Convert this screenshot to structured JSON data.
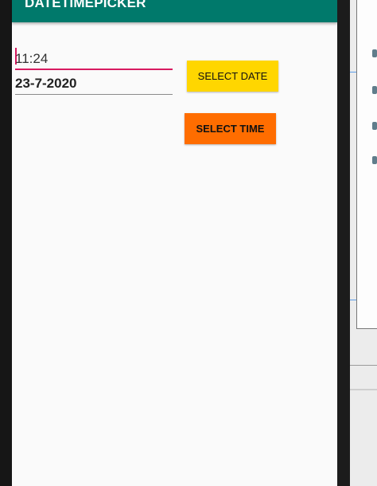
{
  "app": {
    "title": "DATETIMEPICKER"
  },
  "form": {
    "time_value": "11:24",
    "date_value": "23-7-2020"
  },
  "buttons": {
    "select_date": "SELECT DATE",
    "select_time": "SELECT TIME"
  },
  "colors": {
    "appbar": "#00796b",
    "accent": "#d81b60",
    "select_date_button": "#ffd600",
    "select_time_button": "#ff6d00"
  },
  "icons": [
    "edit-icon",
    "palette-icon",
    "square-icon",
    "link-icon"
  ]
}
